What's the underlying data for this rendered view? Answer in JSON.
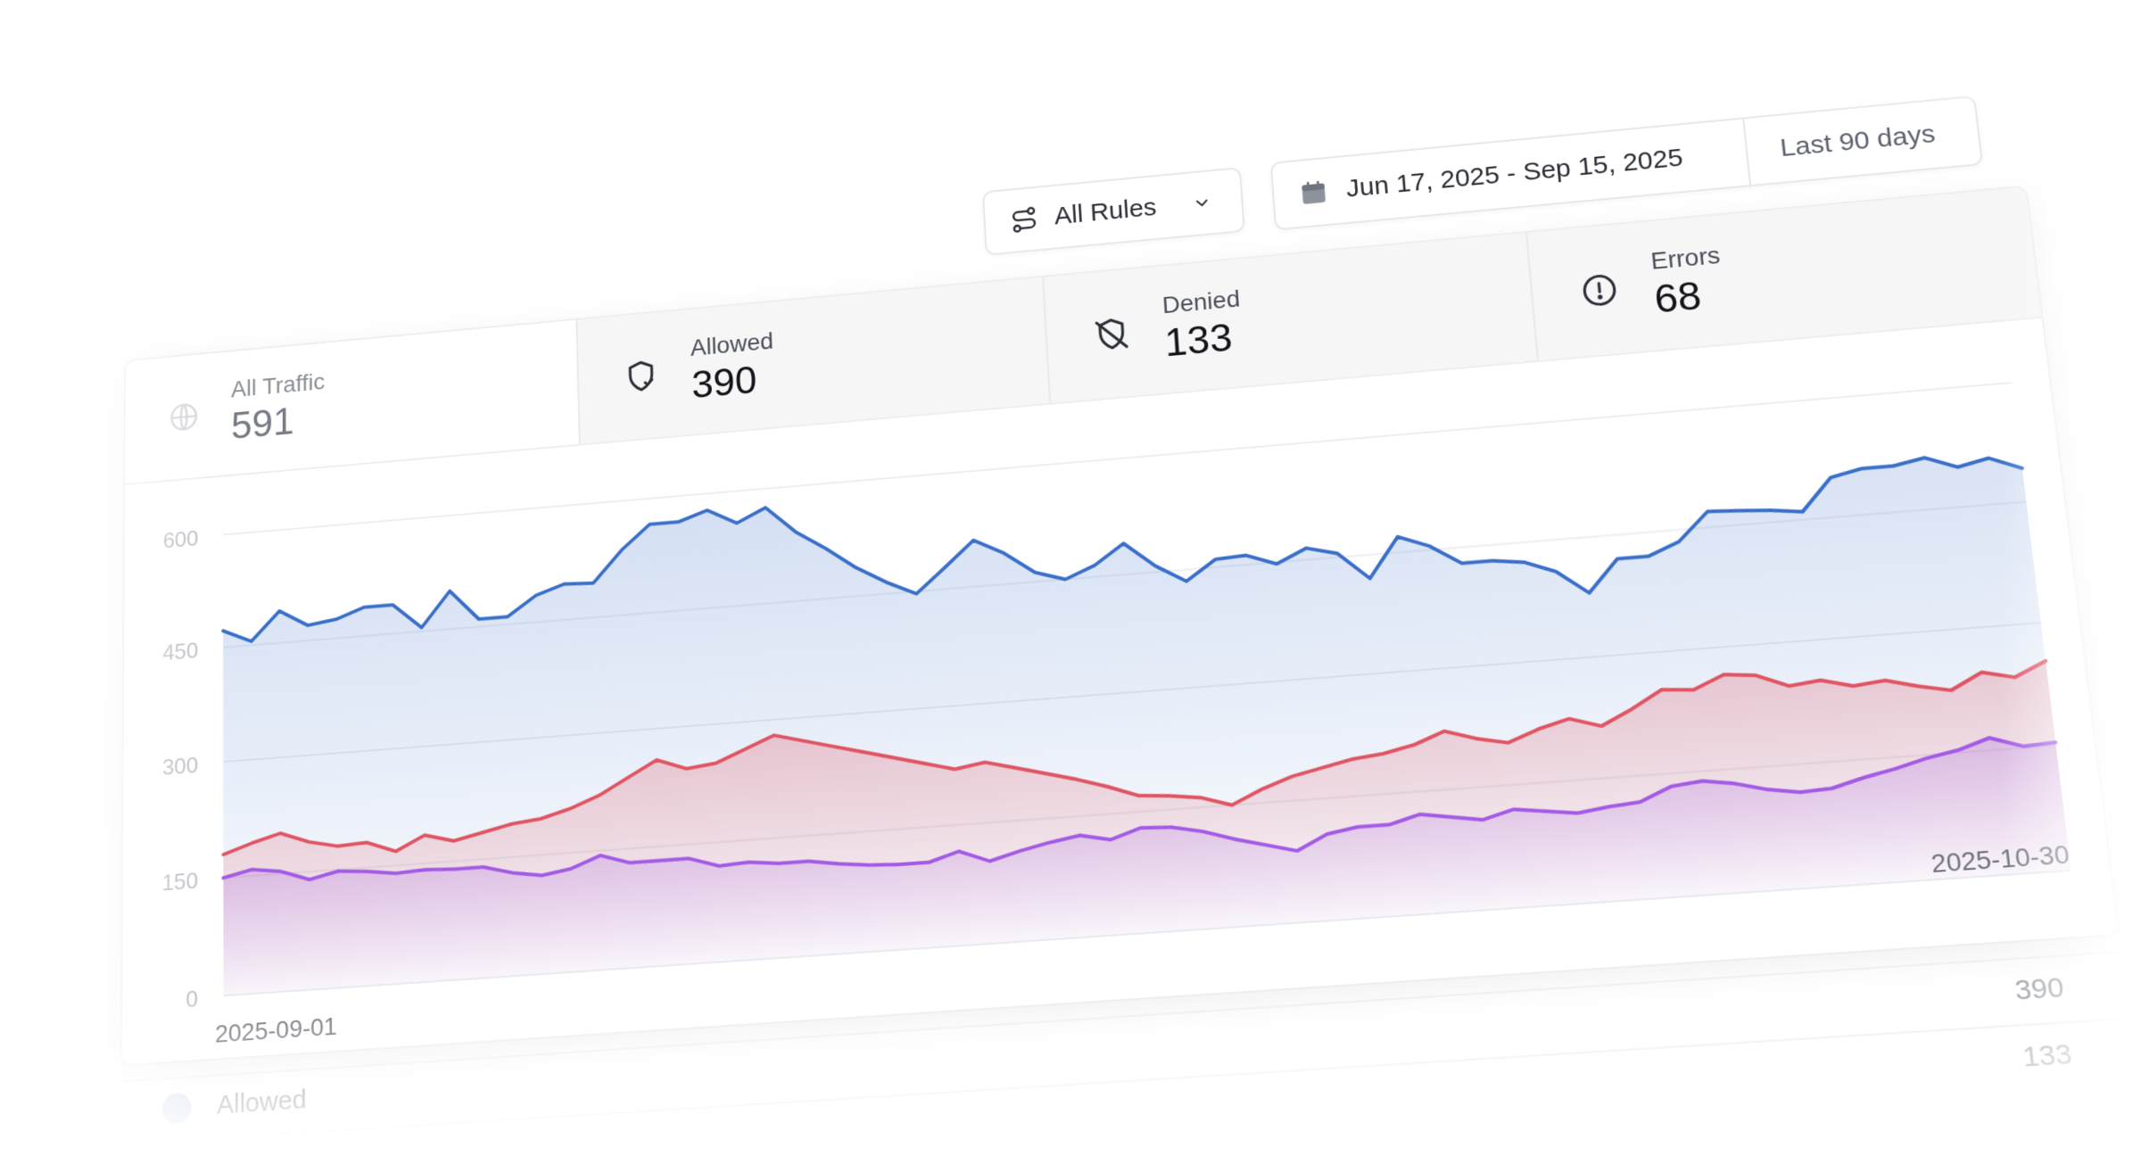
{
  "toolbar": {
    "rules_label": "All Rules",
    "date_range": "Jun 17, 2025 - Sep 15, 2025",
    "date_preset": "Last 90 days"
  },
  "tabs": [
    {
      "label": "All Traffic",
      "value": "591",
      "icon": "globe-icon"
    },
    {
      "label": "Allowed",
      "value": "390",
      "icon": "shield-check-icon"
    },
    {
      "label": "Denied",
      "value": "133",
      "icon": "shield-off-icon"
    },
    {
      "label": "Errors",
      "value": "68",
      "icon": "alert-circle-icon"
    }
  ],
  "legend": [
    {
      "label": "Allowed",
      "value": "390",
      "color": "#cfd9ee"
    },
    {
      "label": "",
      "value": "133",
      "color": "#f2c9cc"
    }
  ],
  "colors": {
    "allowed": "#3a6fc9",
    "denied": "#e05563",
    "errors": "#a35be6"
  },
  "chart_data": {
    "type": "area",
    "x_first": "2025-09-01",
    "x_last": "2025-10-30",
    "ylim": [
      0,
      600
    ],
    "yticks": [
      0,
      150,
      300,
      450,
      600
    ],
    "grid": true,
    "series": [
      {
        "key": "allowed",
        "values": [
          472,
          455,
          492,
          470,
          475,
          488,
          488,
          455,
          500,
          460,
          460,
          485,
          497,
          495,
          535,
          566,
          566,
          578,
          558,
          575,
          540,
          515,
          487,
          465,
          447,
          478,
          510,
          490,
          462,
          450,
          465,
          490,
          458,
          435,
          460,
          462,
          448,
          465,
          455,
          420,
          470,
          455,
          430,
          430,
          425,
          410,
          380,
          420,
          420,
          435,
          470,
          468,
          465,
          460,
          500,
          508,
          508,
          515,
          500,
          508,
          492
        ],
        "color": "#3a6fc9"
      },
      {
        "key": "denied",
        "values": [
          180,
          192,
          202,
          188,
          180,
          182,
          168,
          186,
          176,
          184,
          192,
          196,
          206,
          220,
          240,
          260,
          246,
          250,
          265,
          280,
          270,
          260,
          250,
          240,
          230,
          220,
          226,
          216,
          206,
          196,
          184,
          170,
          167,
          162,
          150,
          167,
          180,
          188,
          196,
          200,
          208,
          222,
          210,
          202,
          216,
          226,
          214,
          232,
          253,
          250,
          266,
          262,
          246,
          250,
          240,
          244,
          234,
          226,
          245,
          236,
          253
        ]
      },
      {
        "key": "errors",
        "values": [
          150,
          158,
          153,
          140,
          148,
          145,
          140,
          142,
          140,
          140,
          130,
          124,
          130,
          144,
          132,
          132,
          132,
          120,
          122,
          118,
          118,
          112,
          108,
          106,
          106,
          117,
          102,
          112,
          120,
          126,
          118,
          130,
          128,
          120,
          108,
          98,
          88,
          106,
          112,
          112,
          122,
          116,
          110,
          120,
          115,
          110,
          115,
          118,
          134,
          138,
          132,
          122,
          116,
          118,
          128,
          136,
          146,
          153,
          165,
          152,
          154
        ]
      }
    ]
  }
}
